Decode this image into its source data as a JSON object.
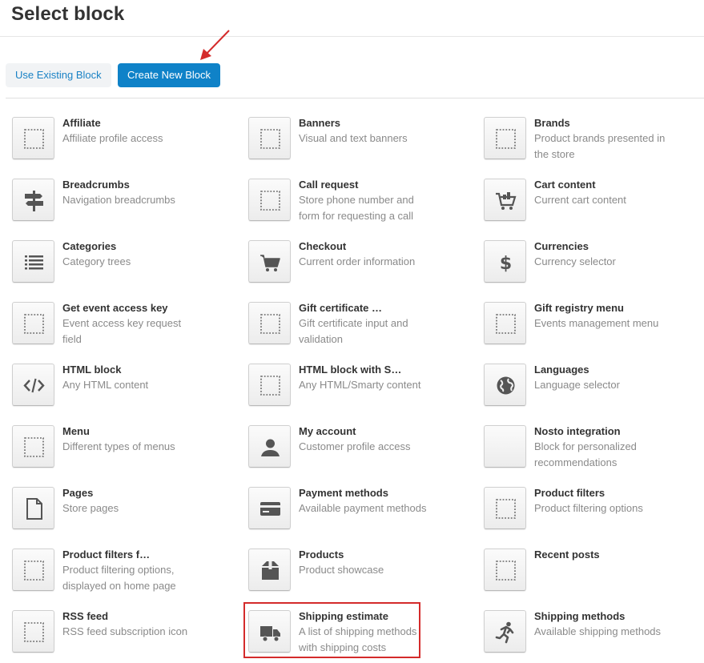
{
  "title": "Select block",
  "buttons": {
    "use_existing": "Use Existing Block",
    "create_new": "Create New Block"
  },
  "colors": {
    "primary": "#0f82c8",
    "link": "#1a82c5",
    "highlight": "#d42b2b",
    "arrow": "#d42b2b"
  },
  "highlighted_block": "Shipping estimate",
  "blocks": [
    {
      "name": "Affiliate",
      "desc": "Affiliate profile access",
      "icon": "placeholder-icon"
    },
    {
      "name": "Banners",
      "desc": "Visual and text banners",
      "icon": "placeholder-icon"
    },
    {
      "name": "Brands",
      "desc": "Product brands presented in the store",
      "icon": "placeholder-icon"
    },
    {
      "name": "Breadcrumbs",
      "desc": "Navigation breadcrumbs",
      "icon": "signpost-icon"
    },
    {
      "name": "Call request",
      "desc": "Store phone number and form for requesting a call",
      "icon": "placeholder-icon"
    },
    {
      "name": "Cart content",
      "desc": "Current cart content",
      "icon": "cart-full-icon"
    },
    {
      "name": "Categories",
      "desc": "Category trees",
      "icon": "list-icon"
    },
    {
      "name": "Checkout",
      "desc": "Current order information",
      "icon": "cart-icon"
    },
    {
      "name": "Currencies",
      "desc": "Currency selector",
      "icon": "dollar-icon"
    },
    {
      "name": "Get event access key",
      "desc": "Event access key request field",
      "icon": "placeholder-icon"
    },
    {
      "name": "Gift certificate …",
      "desc": "Gift certificate input and validation",
      "icon": "placeholder-icon"
    },
    {
      "name": "Gift registry menu",
      "desc": "Events management menu",
      "icon": "placeholder-icon"
    },
    {
      "name": "HTML block",
      "desc": "Any HTML content",
      "icon": "code-icon"
    },
    {
      "name": "HTML block with S…",
      "desc": "Any HTML/Smarty content",
      "icon": "placeholder-icon"
    },
    {
      "name": "Languages",
      "desc": "Language selector",
      "icon": "globe-icon"
    },
    {
      "name": "Menu",
      "desc": "Different types of menus",
      "icon": "placeholder-icon"
    },
    {
      "name": "My account",
      "desc": "Customer profile access",
      "icon": "user-icon"
    },
    {
      "name": "Nosto integration",
      "desc": "Block for personalized recommendations",
      "icon": "blank-icon"
    },
    {
      "name": "Pages",
      "desc": "Store pages",
      "icon": "page-icon"
    },
    {
      "name": "Payment methods",
      "desc": "Available payment methods",
      "icon": "credit-card-icon"
    },
    {
      "name": "Product filters",
      "desc": "Product filtering options",
      "icon": "placeholder-icon"
    },
    {
      "name": "Product filters f…",
      "desc": "Product filtering options, displayed on home page",
      "icon": "placeholder-icon"
    },
    {
      "name": "Products",
      "desc": "Product showcase",
      "icon": "box-icon"
    },
    {
      "name": "Recent posts",
      "desc": "",
      "icon": "placeholder-icon"
    },
    {
      "name": "RSS feed",
      "desc": "RSS feed subscription icon",
      "icon": "placeholder-icon"
    },
    {
      "name": "Shipping estimate",
      "desc": "A list of shipping methods with shipping costs",
      "icon": "truck-icon"
    },
    {
      "name": "Shipping methods",
      "desc": "Available shipping methods",
      "icon": "runner-icon"
    }
  ]
}
